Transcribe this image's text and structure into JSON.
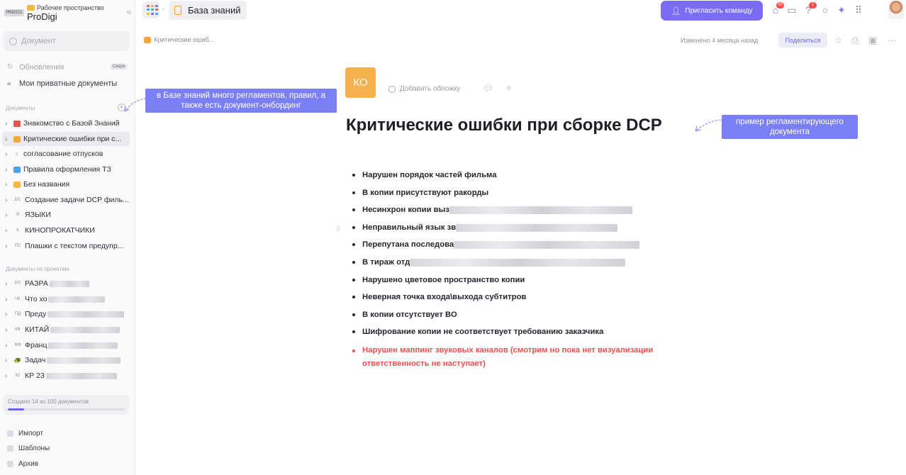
{
  "workspace": {
    "logo_text": "PRODIGI",
    "label": "Рабочее пространство",
    "name": "ProDigi"
  },
  "sidebar": {
    "search_placeholder": "Документ",
    "updates_label": "Обновления",
    "updates_badge": "Скоро",
    "private_docs_label": "Мои приватные документы",
    "documents_section": "Документы",
    "documents": [
      {
        "label": "Знакомство с Базой Знаний",
        "icon_color": "#e8544e"
      },
      {
        "label": "Критические ошибки при с...",
        "icon_color": "#f4a63c"
      },
      {
        "label": "согласование отпусков",
        "icon_color": "#9b6cf0"
      },
      {
        "label": "Правила оформления ТЗ",
        "icon_color": "#4aa3f0"
      },
      {
        "label": "Без названия",
        "icon_color": "#f4b740"
      },
      {
        "label": "Создание задачи DCP филь...",
        "icon_text": "DC"
      },
      {
        "label": "ЯЗЫКИ",
        "icon_text": "Я"
      },
      {
        "label": "КИНОПРОКАТЧИКИ",
        "icon_text": "К"
      },
      {
        "label": "Плашки с текстом предупр...",
        "icon_text": "ПС"
      }
    ],
    "projects_section": "Документы по проектам",
    "projects": [
      {
        "label": "РАЗРА",
        "icon_text": "РП"
      },
      {
        "label": "Что хо",
        "icon_text": "ЧК"
      },
      {
        "label": "Преду",
        "icon_text": "ПД"
      },
      {
        "label": "КИТАЙ",
        "icon_text": "КФ"
      },
      {
        "label": "Франц",
        "icon_text": "ФФ"
      },
      {
        "label": "Задач",
        "icon_text": "🐢"
      },
      {
        "label": "КР 23",
        "icon_text": "К2"
      }
    ],
    "quota_text": "Создано 14 из 100 документов",
    "quota_fraction": 0.14,
    "footer": [
      "Импорт",
      "Шаблоны",
      "Архив"
    ]
  },
  "topbar": {
    "tab_title": "База знаний",
    "invite_label": "Пригласить команду",
    "notif_count_1": "99",
    "notif_count_2": "2"
  },
  "doc_header": {
    "breadcrumb": "Критические ошиб...",
    "modified": "Изменено 4 месяца назад",
    "share_label": "Поделиться"
  },
  "document": {
    "avatar_text": "КО",
    "add_cover_label": "Добавить обложку",
    "title": "Критические ошибки при сборке DCP",
    "bullets": [
      {
        "text": "Нарушен порядок частей фильма",
        "blur": 0
      },
      {
        "text": "В копии присутствуют ракорды",
        "blur": 0
      },
      {
        "text": "Несинхрон копии выз",
        "blur": 258
      },
      {
        "text": "Неправильный язык зв",
        "blur": 228
      },
      {
        "text": "Перепутана последова",
        "blur": 262
      },
      {
        "text": "В тираж отд",
        "blur": 304
      },
      {
        "text": "Нарушено цветовое пространство копии",
        "blur": 0
      },
      {
        "text": "Неверная точка входа\\выхода субтитров",
        "blur": 0
      },
      {
        "text": "В копии отсутствует ВО",
        "blur": 0
      },
      {
        "text": "Шифрование копии не соответствует требованию заказчика",
        "blur": 0
      }
    ],
    "red_bullet": "Нарушен маппинг звуковых каналов  (смотрим но пока нет визуализации ответственность не наступает)"
  },
  "annotations": {
    "left": "в Базе знаний много регламентов, правил, а также есть документ-онбординг",
    "right": "пример регламентирующего документа",
    "color": "#7b7ff5"
  },
  "colors": {
    "accent": "#7b6cf6",
    "danger": "#f04e4e",
    "doc_orange": "#f4b14d"
  }
}
